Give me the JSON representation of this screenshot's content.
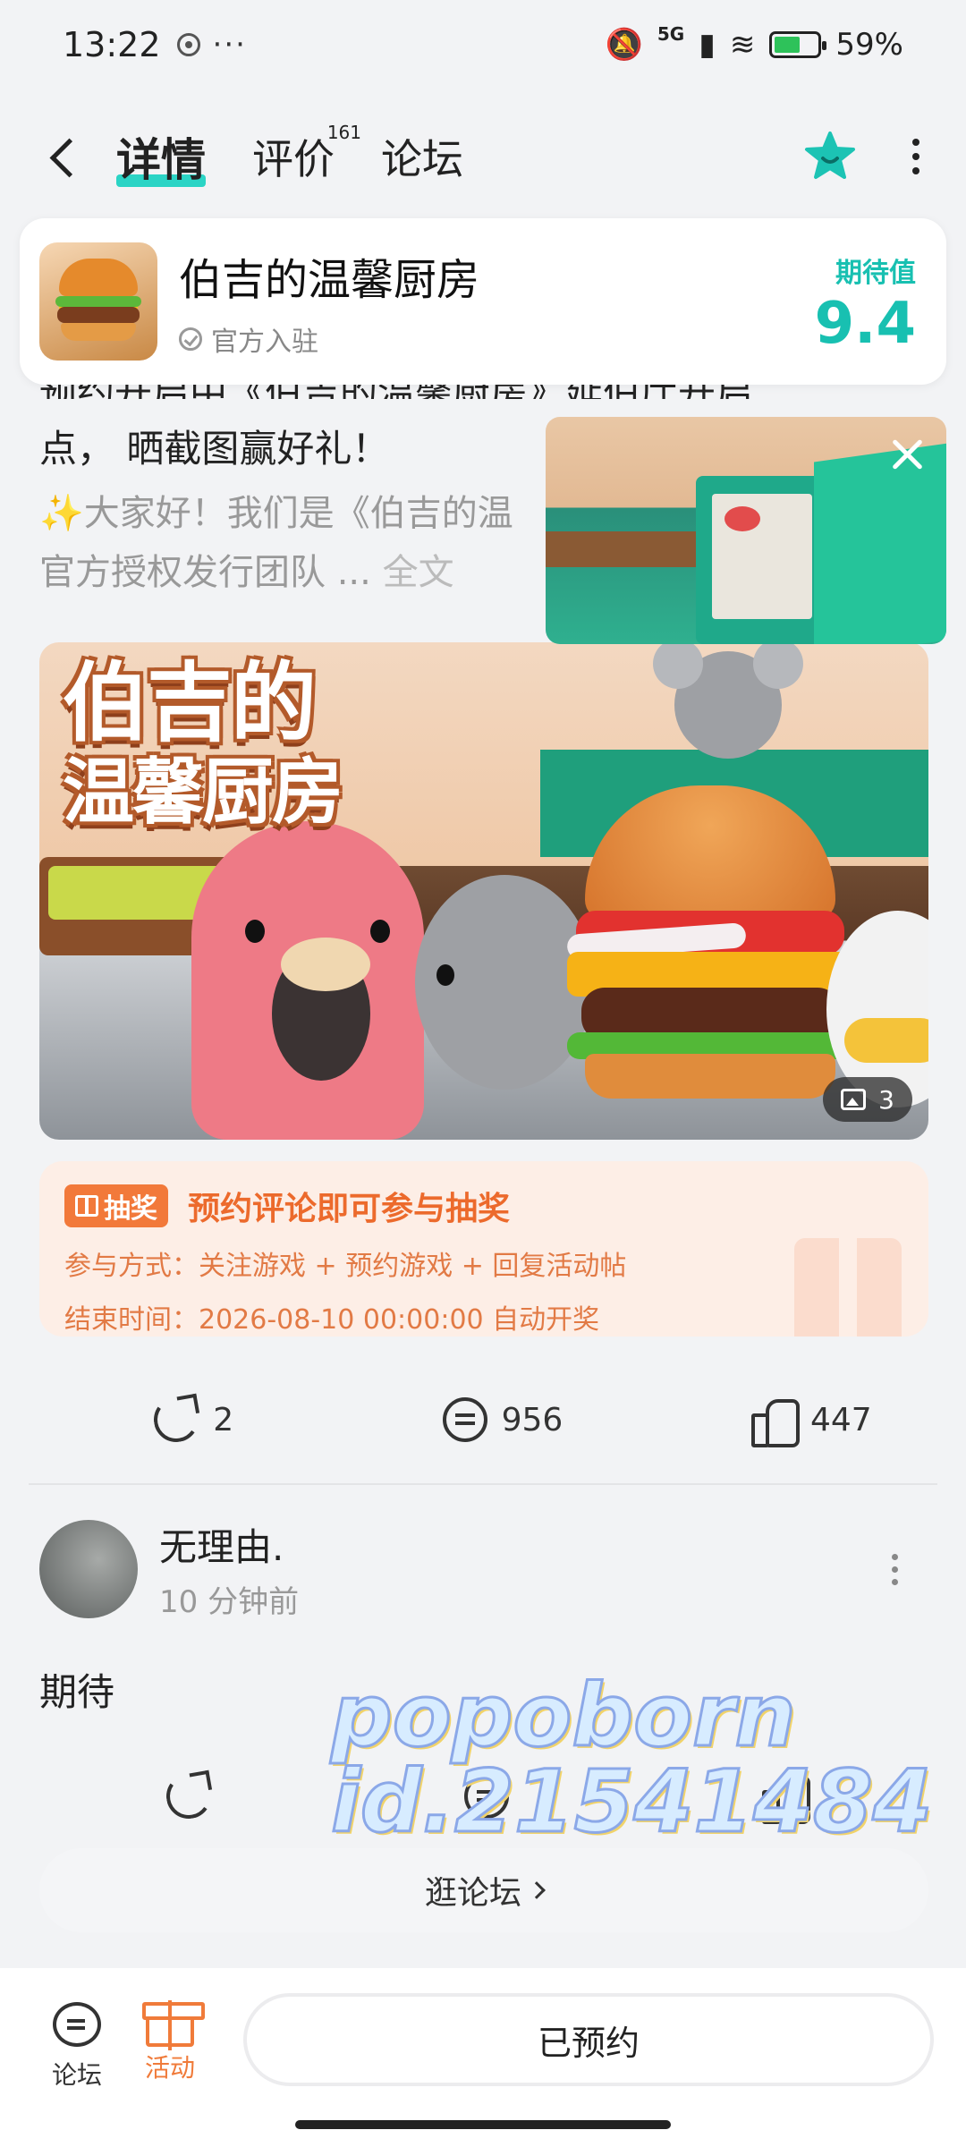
{
  "status_bar": {
    "time": "13:22",
    "more": "···",
    "network": "5G",
    "battery": "59%"
  },
  "nav": {
    "tabs": [
      {
        "label": "详情",
        "active": true
      },
      {
        "label": "评价",
        "badge": "161"
      },
      {
        "label": "论坛"
      }
    ]
  },
  "game": {
    "title": "伯吉的温馨厨房",
    "official": "官方入驻",
    "expect_label": "期待值",
    "expect_score": "9.4"
  },
  "post": {
    "clipped_line": "预约开启中《伯吉的温馨厨房》延伯厅开启",
    "line2": "点， 晒截图赢好礼！",
    "body": "✨大家好！我们是《伯吉的温馨厨房》官方授权发行团队",
    "body_line1": "✨大家好！我们是《伯吉的温",
    "body_line2": "官方授权发行团队 ... ",
    "fulltext": "全文"
  },
  "media": {
    "logo_line1": "伯吉的",
    "logo_line2": "温馨厨房",
    "image_count": "3"
  },
  "lottery": {
    "badge": "抽奖",
    "title": "预约评论即可参与抽奖",
    "method": "参与方式：关注游戏 + 预约游戏 + 回复活动帖",
    "end_time": "结束时间：2026-08-10 00:00:00 自动开奖"
  },
  "stats": {
    "shares": "2",
    "comments": "956",
    "likes": "447"
  },
  "comment": {
    "user": "无理由.",
    "time": "10 分钟前",
    "text": "期待"
  },
  "watermark": {
    "line1": "popoborn",
    "line2": "id.21541484"
  },
  "forum_button": "逛论坛",
  "bottom_bar": {
    "forum": "论坛",
    "activity": "活动",
    "reserved": "已预约"
  },
  "colors": {
    "accent": "#18c0b1",
    "lottery_orange": "#ec6a2c",
    "activity_orange": "#f07b3a"
  }
}
